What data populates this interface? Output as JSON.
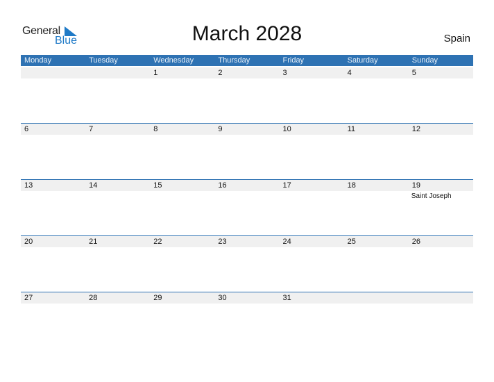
{
  "logo": {
    "general": "General",
    "blue": "Blue"
  },
  "title": "March 2028",
  "country": "Spain",
  "weekdays": [
    "Monday",
    "Tuesday",
    "Wednesday",
    "Thursday",
    "Friday",
    "Saturday",
    "Sunday"
  ],
  "weeks": [
    {
      "days": [
        "",
        "",
        "1",
        "2",
        "3",
        "4",
        "5"
      ],
      "events": [
        "",
        "",
        "",
        "",
        "",
        "",
        ""
      ]
    },
    {
      "days": [
        "6",
        "7",
        "8",
        "9",
        "10",
        "11",
        "12"
      ],
      "events": [
        "",
        "",
        "",
        "",
        "",
        "",
        ""
      ]
    },
    {
      "days": [
        "13",
        "14",
        "15",
        "16",
        "17",
        "18",
        "19"
      ],
      "events": [
        "",
        "",
        "",
        "",
        "",
        "",
        "Saint Joseph"
      ]
    },
    {
      "days": [
        "20",
        "21",
        "22",
        "23",
        "24",
        "25",
        "26"
      ],
      "events": [
        "",
        "",
        "",
        "",
        "",
        "",
        ""
      ]
    },
    {
      "days": [
        "27",
        "28",
        "29",
        "30",
        "31",
        "",
        ""
      ],
      "events": [
        "",
        "",
        "",
        "",
        "",
        "",
        ""
      ]
    }
  ]
}
